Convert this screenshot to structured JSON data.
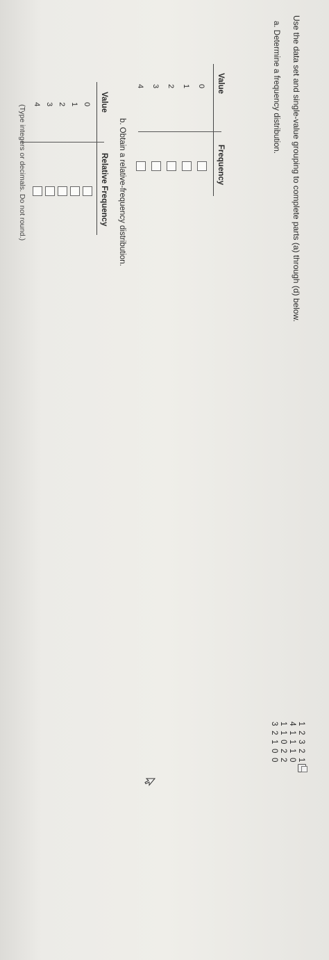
{
  "instruction": "Use the data set and single-value grouping to complete parts (a) through (d) below.",
  "dataset": [
    [
      "1",
      "2",
      "3",
      "2",
      "1"
    ],
    [
      "4",
      "1",
      "1",
      "1",
      "0"
    ],
    [
      "1",
      "1",
      "0",
      "2",
      "2"
    ],
    [
      "3",
      "2",
      "1",
      "0",
      "0"
    ]
  ],
  "part_a": {
    "label": "a. Determine a frequency distribution.",
    "col_value": "Value",
    "col_freq": "Frequency",
    "values": [
      "0",
      "1",
      "2",
      "3",
      "4"
    ]
  },
  "part_b": {
    "label": "b. Obtain a relative-frequency distribution.",
    "col_value": "Value",
    "col_freq": "Relative Frequency",
    "values": [
      "0",
      "1",
      "2",
      "3",
      "4"
    ]
  },
  "hint": "(Type integers or decimals. Do not round.)"
}
